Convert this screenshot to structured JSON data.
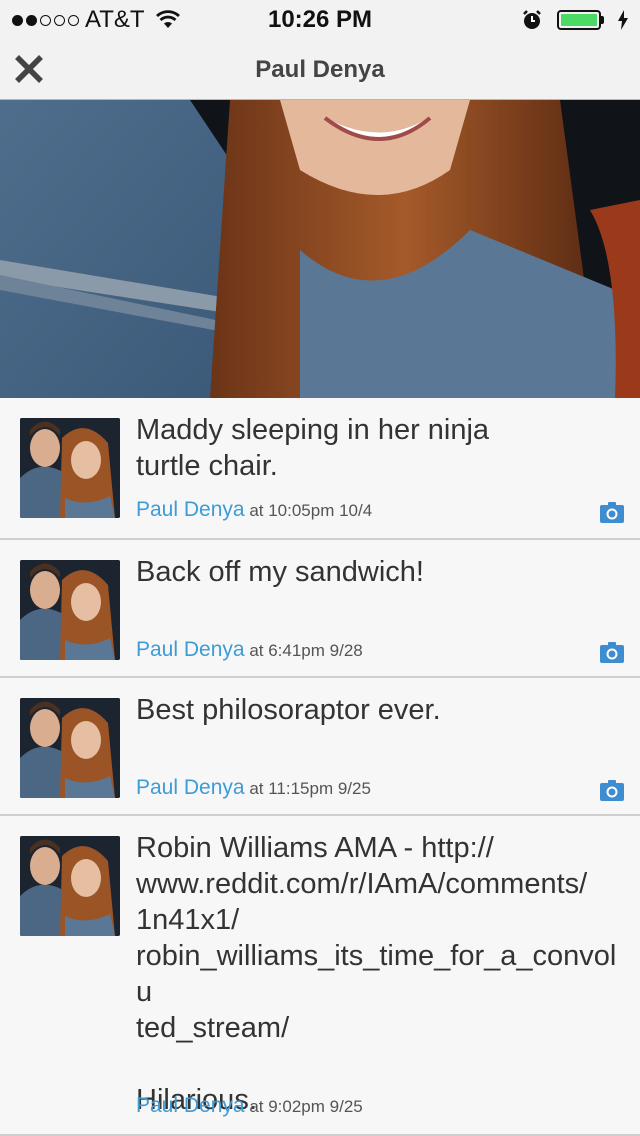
{
  "status_bar": {
    "carrier": "AT&T",
    "time": "10:26 PM",
    "signal_bars": 2,
    "battery_level": 1.0,
    "colors": {
      "battery": "#4cd964"
    }
  },
  "nav": {
    "title": "Paul Denya",
    "close_icon": "close-icon"
  },
  "colors": {
    "author_link": "#3d9cd6",
    "camera_icon": "#3d8dd0"
  },
  "feed": [
    {
      "text": "Maddy sleeping in her ninja\nturtle chair.",
      "author": "Paul Denya",
      "timestamp": "at 10:05pm 10/4",
      "has_photo": true
    },
    {
      "text": "Back off my sandwich!",
      "author": "Paul Denya",
      "timestamp": "at 6:41pm 9/28",
      "has_photo": true
    },
    {
      "text": "Best philosoraptor ever.",
      "author": "Paul Denya",
      "timestamp": "at 11:15pm 9/25",
      "has_photo": true
    },
    {
      "text": "Robin Williams AMA - http://\nwww.reddit.com/r/IAmA/comments/\n1n41x1/\nrobin_williams_its_time_for_a_convolu\nted_stream/\n\nHilarious.",
      "author": "Paul Denya",
      "timestamp": "at 9:02pm 9/25",
      "has_photo": false
    }
  ]
}
